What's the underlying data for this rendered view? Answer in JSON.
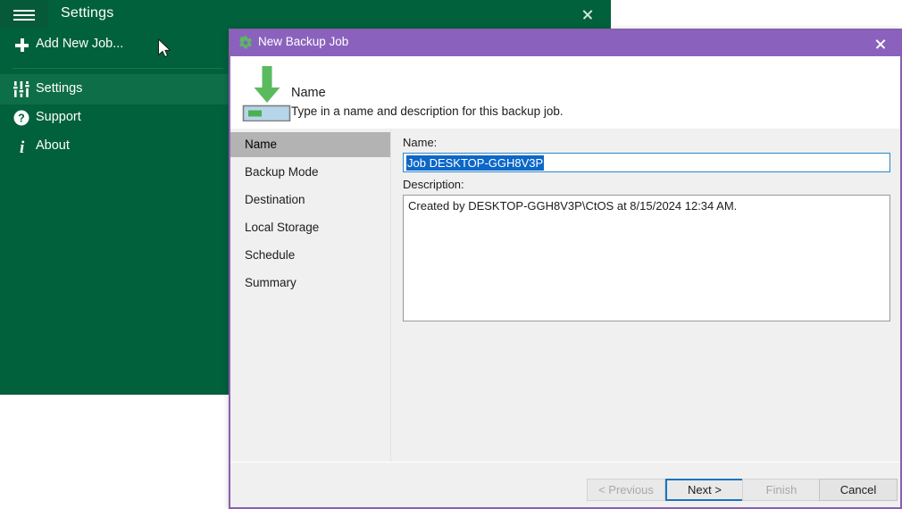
{
  "app": {
    "title": "Settings",
    "hamburger_icon": "hamburger-menu-icon",
    "close_icon": "close-icon",
    "sidebar": {
      "items": [
        {
          "label": "Add New Job...",
          "icon": "plus-icon"
        },
        {
          "label": "Settings",
          "icon": "sliders-icon"
        },
        {
          "label": "Support",
          "icon": "question-circle-icon"
        },
        {
          "label": "About",
          "icon": "info-icon"
        }
      ]
    }
  },
  "dialog": {
    "title": "New Backup Job",
    "title_icon": "gear-icon",
    "close_icon": "close-icon",
    "header": {
      "icon": "backup-to-disk-icon",
      "title": "Name",
      "subtitle": "Type in a name and description for this backup job."
    },
    "steps": [
      {
        "label": "Name",
        "active": true
      },
      {
        "label": "Backup Mode",
        "active": false
      },
      {
        "label": "Destination",
        "active": false
      },
      {
        "label": "Local Storage",
        "active": false
      },
      {
        "label": "Schedule",
        "active": false
      },
      {
        "label": "Summary",
        "active": false
      }
    ],
    "form": {
      "name_label": "Name:",
      "name_value": "Job DESKTOP-GGH8V3P",
      "description_label": "Description:",
      "description_value": "Created by DESKTOP-GGH8V3P\\CtOS at 8/15/2024 12:34 AM."
    },
    "buttons": {
      "previous": "< Previous",
      "next": "Next >",
      "finish": "Finish",
      "cancel": "Cancel"
    }
  },
  "colors": {
    "app_green": "#00613c",
    "sidebar_highlight": "#0e6e47",
    "dialog_purple": "#8a62bd",
    "selection_blue": "#0d67c8",
    "focus_blue": "#1a75bb",
    "icon_green": "#4caf50"
  }
}
